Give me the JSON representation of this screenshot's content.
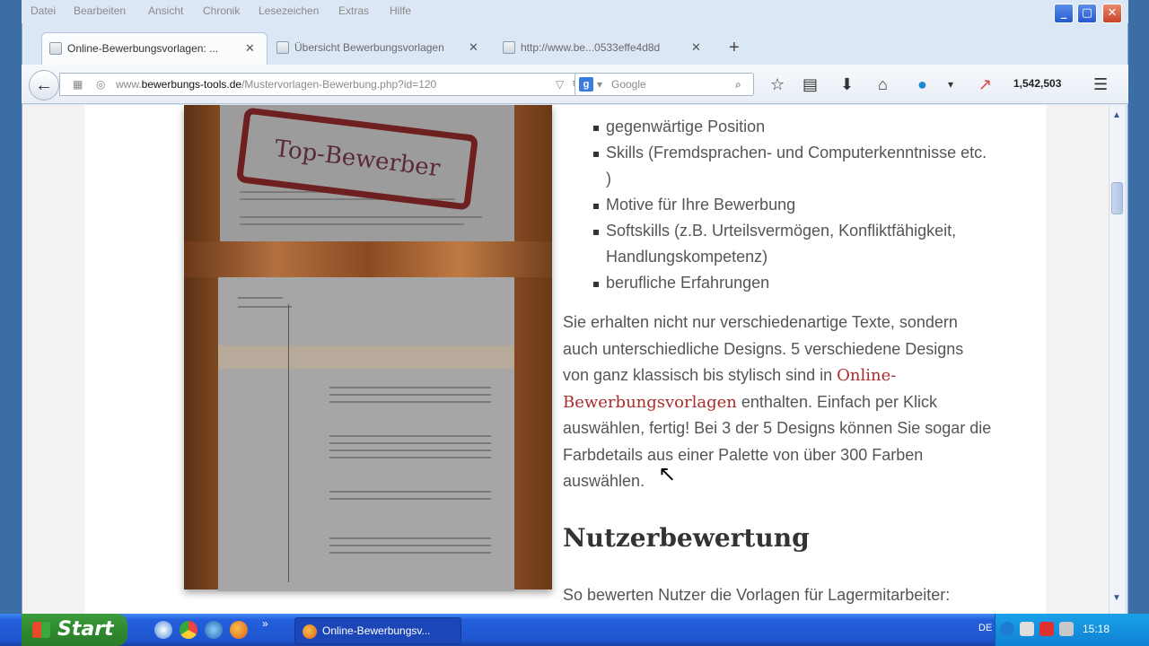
{
  "menu": [
    "Datei",
    "Bearbeiten",
    "Ansicht",
    "Chronik",
    "Lesezeichen",
    "Extras",
    "Hilfe"
  ],
  "tabs": [
    {
      "label": "Online-Bewerbungsvorlagen: ...",
      "active": true
    },
    {
      "label": "Übersicht Bewerbungsvorlagen",
      "active": false
    },
    {
      "label": "http://www.be...0533effe4d8d",
      "active": false
    }
  ],
  "url": {
    "prefix": "www.",
    "host": "bewerbungs-tools.de",
    "path": "/Mustervorlagen-Bewerbung.php?id=120"
  },
  "search": {
    "placeholder": "Google"
  },
  "toolbar": {
    "counter": "1,542,503"
  },
  "stamp_text": "Top-Bewerber",
  "bullets": [
    "gegenwärtige Position",
    "Skills (Fremdsprachen- und Computerkenntnisse etc. )",
    "Motive für Ihre Bewerbung",
    "Softskills (z.B. Urteilsvermögen, Konfliktfähigkeit, Handlungskompetenz)",
    "berufliche Erfahrungen"
  ],
  "paragraph": {
    "before": "Sie erhalten nicht nur verschiedenartige Texte, sondern auch unterschiedliche Designs. 5 verschiedene Designs von ganz klassisch bis stylisch sind in ",
    "link": "Online-Bewerbungsvorlagen",
    "after": " enthalten. Einfach per Klick auswählen, fertig! Bei 3 der 5 Designs können Sie sogar die Farbdetails aus einer Palette von über 300 Farben auswählen."
  },
  "heading": "Nutzerbewertung",
  "paragraph2": "So bewerten Nutzer die Vorlagen für Lagermitarbeiter:",
  "taskbar": {
    "start": "Start",
    "task": "Online-Bewerbungsv...",
    "lang": "DE",
    "clock": "15:18"
  },
  "colors": {
    "link": "#a82c2c",
    "taskbar": "#245edb",
    "start": "#2f8a2f"
  }
}
